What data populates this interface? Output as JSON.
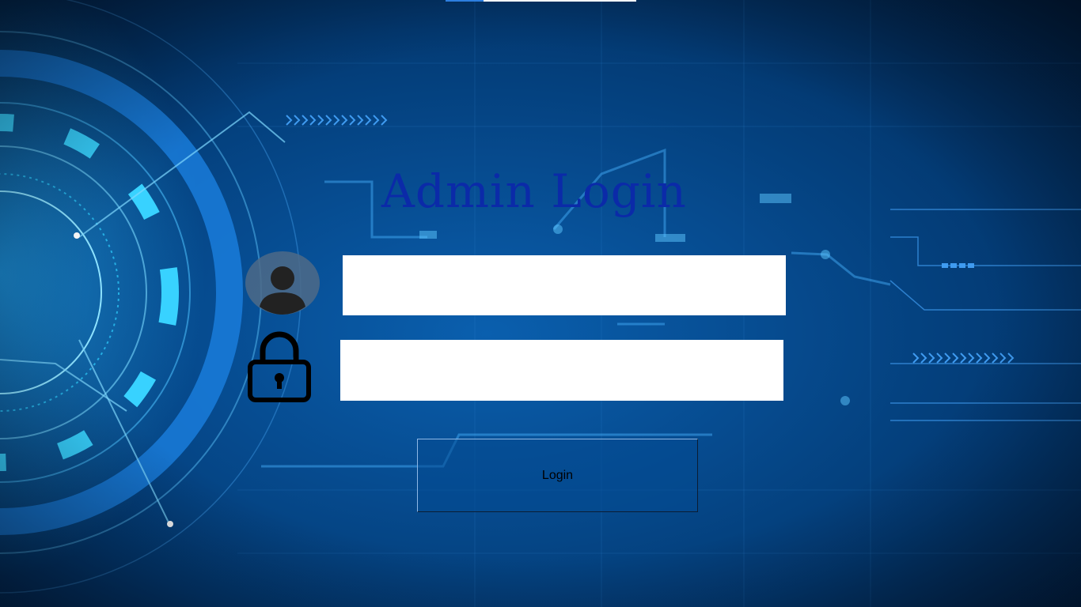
{
  "login_form": {
    "title": "Admin Login",
    "username": {
      "value": "",
      "placeholder": ""
    },
    "password": {
      "value": "",
      "placeholder": ""
    },
    "submit_label": "Login"
  },
  "icons": {
    "username": "user-avatar-icon",
    "password": "padlock-icon"
  },
  "colors": {
    "background": "#064b8f",
    "title": "#0b2aa8",
    "field_background": "#ffffff",
    "accent": "#2fd0ff"
  }
}
